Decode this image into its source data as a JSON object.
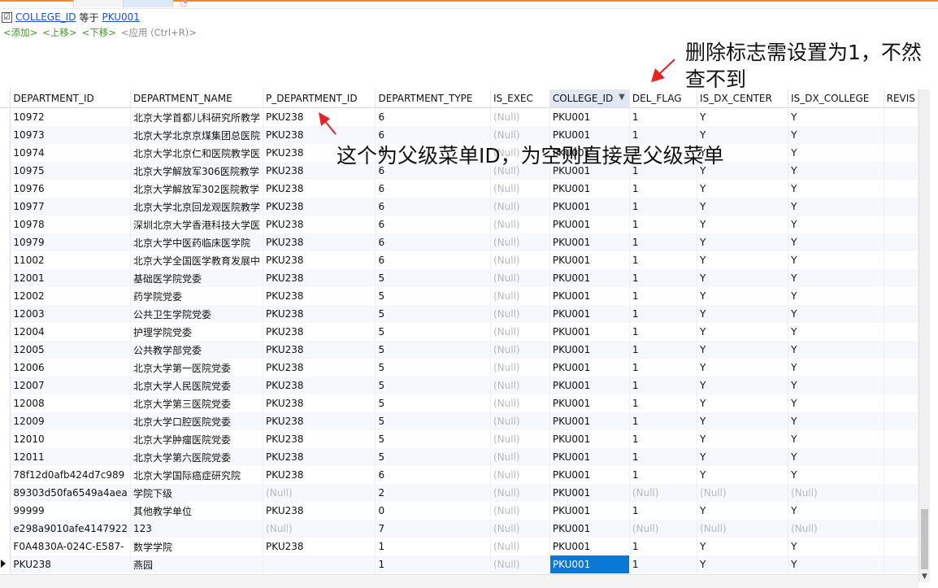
{
  "filter": {
    "field": "COLLEGE_ID",
    "operator": "等于",
    "value": "PKU001",
    "checked": "☑"
  },
  "actions": [
    {
      "label": "<添加>",
      "enabled": true
    },
    {
      "label": "<上移>",
      "enabled": true
    },
    {
      "label": "<下移>",
      "enabled": true
    },
    {
      "label": "<应用 (Ctrl+R)>",
      "enabled": false
    }
  ],
  "annotations": {
    "del_flag_note": "删除标志需设置为1，不然查不到",
    "parent_note": "这个为父级菜单ID，为空则直接是父级菜单"
  },
  "colors": {
    "accent": "#f08a24",
    "selected_cell": "#0a78d6",
    "link": "#1a4fd6",
    "action": "#3a9a1e",
    "annotation_arrow": "#e82020"
  },
  "grid": {
    "columns": [
      "DEPARTMENT_ID",
      "DEPARTMENT_NAME",
      "P_DEPARTMENT_ID",
      "DEPARTMENT_TYPE",
      "IS_EXEC",
      "COLLEGE_ID",
      "DEL_FLAG",
      "IS_DX_CENTER",
      "IS_DX_COLLEGE",
      "REVIS"
    ],
    "filtered_column": "COLLEGE_ID",
    "rows": [
      [
        "10972",
        "北京大学首都儿科研究所教学",
        "PKU238",
        "6",
        "(Null)",
        "PKU001",
        "1",
        "Y",
        "Y",
        ""
      ],
      [
        "10973",
        "北京大学北京京煤集团总医院",
        "PKU238",
        "6",
        "(Null)",
        "PKU001",
        "1",
        "Y",
        "Y",
        ""
      ],
      [
        "10974",
        "北京大学北京仁和医院教学医",
        "PKU238",
        "6",
        "(Null)",
        "PKU001",
        "1",
        "Y",
        "Y",
        ""
      ],
      [
        "10975",
        "北京大学解放军306医院教学",
        "PKU238",
        "6",
        "(Null)",
        "PKU001",
        "1",
        "Y",
        "Y",
        ""
      ],
      [
        "10976",
        "北京大学解放军302医院教学",
        "PKU238",
        "6",
        "(Null)",
        "PKU001",
        "1",
        "Y",
        "Y",
        ""
      ],
      [
        "10977",
        "北京大学北京回龙观医院教学",
        "PKU238",
        "6",
        "(Null)",
        "PKU001",
        "1",
        "Y",
        "Y",
        ""
      ],
      [
        "10978",
        "深圳北京大学香港科技大学医",
        "PKU238",
        "6",
        "(Null)",
        "PKU001",
        "1",
        "Y",
        "Y",
        ""
      ],
      [
        "10979",
        "北京大学中医药临床医学院",
        "PKU238",
        "6",
        "(Null)",
        "PKU001",
        "1",
        "Y",
        "Y",
        ""
      ],
      [
        "11002",
        "北京大学全国医学教育发展中",
        "PKU238",
        "6",
        "(Null)",
        "PKU001",
        "1",
        "Y",
        "Y",
        ""
      ],
      [
        "12001",
        "基础医学院党委",
        "PKU238",
        "5",
        "(Null)",
        "PKU001",
        "1",
        "Y",
        "Y",
        ""
      ],
      [
        "12002",
        "药学院党委",
        "PKU238",
        "5",
        "(Null)",
        "PKU001",
        "1",
        "Y",
        "Y",
        ""
      ],
      [
        "12003",
        "公共卫生学院党委",
        "PKU238",
        "5",
        "(Null)",
        "PKU001",
        "1",
        "Y",
        "Y",
        ""
      ],
      [
        "12004",
        "护理学院党委",
        "PKU238",
        "5",
        "(Null)",
        "PKU001",
        "1",
        "Y",
        "Y",
        ""
      ],
      [
        "12005",
        "公共教学部党委",
        "PKU238",
        "5",
        "(Null)",
        "PKU001",
        "1",
        "Y",
        "Y",
        ""
      ],
      [
        "12006",
        "北京大学第一医院党委",
        "PKU238",
        "5",
        "(Null)",
        "PKU001",
        "1",
        "Y",
        "Y",
        ""
      ],
      [
        "12007",
        "北京大学人民医院党委",
        "PKU238",
        "5",
        "(Null)",
        "PKU001",
        "1",
        "Y",
        "Y",
        ""
      ],
      [
        "12008",
        "北京大学第三医院党委",
        "PKU238",
        "5",
        "(Null)",
        "PKU001",
        "1",
        "Y",
        "Y",
        ""
      ],
      [
        "12009",
        "北京大学口腔医院党委",
        "PKU238",
        "5",
        "(Null)",
        "PKU001",
        "1",
        "Y",
        "Y",
        ""
      ],
      [
        "12010",
        "北京大学肿瘤医院党委",
        "PKU238",
        "5",
        "(Null)",
        "PKU001",
        "1",
        "Y",
        "Y",
        ""
      ],
      [
        "12011",
        "北京大学第六医院党委",
        "PKU238",
        "5",
        "(Null)",
        "PKU001",
        "1",
        "Y",
        "Y",
        ""
      ],
      [
        "78f12d0afb424d7c989",
        "北京大学国际癌症研究院",
        "PKU238",
        "6",
        "(Null)",
        "PKU001",
        "1",
        "Y",
        "Y",
        ""
      ],
      [
        "89303d50fa6549a4aea",
        "学院下级",
        "(Null)",
        "2",
        "(Null)",
        "PKU001",
        "(Null)",
        "(Null)",
        "(Null)",
        ""
      ],
      [
        "99999",
        "其他教学单位",
        "PKU238",
        "0",
        "(Null)",
        "PKU001",
        "1",
        "Y",
        "Y",
        ""
      ],
      [
        "e298a9010afe4147922",
        "123",
        "(Null)",
        "7",
        "(Null)",
        "PKU001",
        "(Null)",
        "(Null)",
        "(Null)",
        ""
      ],
      [
        "F0A4830A-024C-E587-",
        "数学学院",
        "PKU238",
        "1",
        "(Null)",
        "PKU001",
        "1",
        "Y",
        "Y",
        ""
      ],
      [
        "PKU238",
        "燕园",
        "",
        "1",
        "(Null)",
        "PKU001",
        "1",
        "Y",
        "Y",
        ""
      ]
    ],
    "current_row": 25,
    "current_col": 5
  }
}
